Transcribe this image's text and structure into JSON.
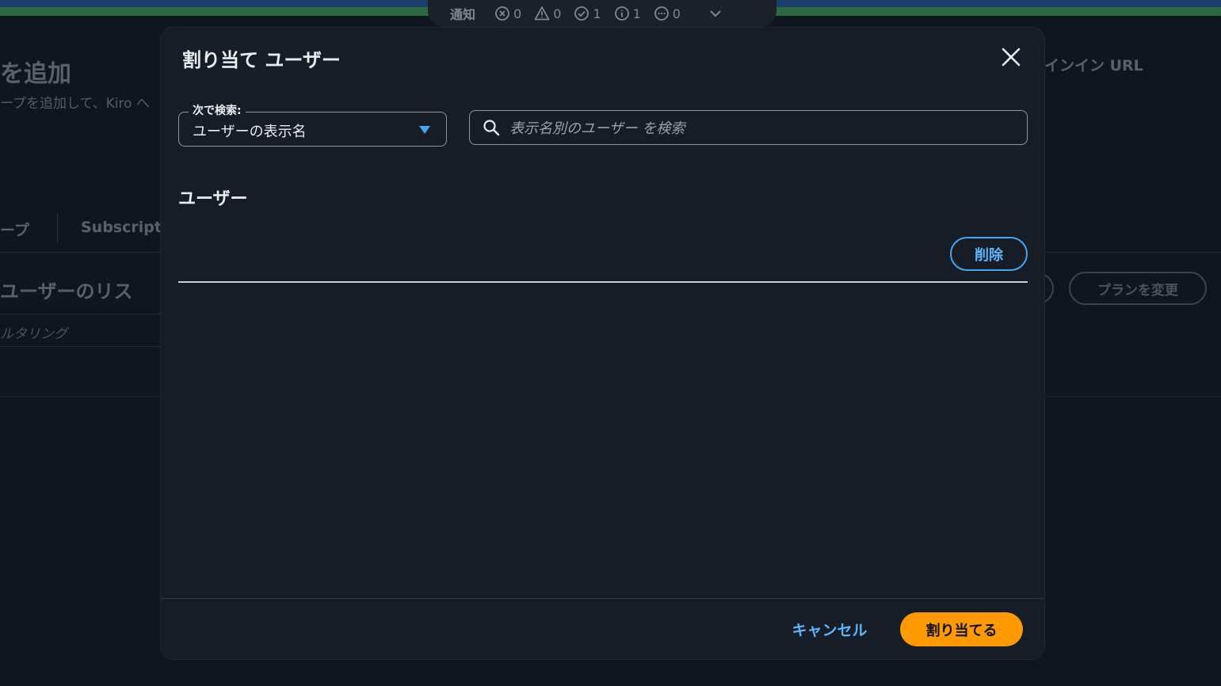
{
  "notifications": {
    "label": "通知",
    "items": [
      {
        "icon": "error-icon",
        "count": "0"
      },
      {
        "icon": "warning-icon",
        "count": "0"
      },
      {
        "icon": "success-icon",
        "count": "1"
      },
      {
        "icon": "info-icon",
        "count": "1"
      },
      {
        "icon": "pending-icon",
        "count": "0"
      }
    ]
  },
  "background": {
    "title": "を追加",
    "description": "ープを追加して、Kiro へ",
    "tabs": [
      "ープ",
      "Subscripti"
    ],
    "list_title": "ユーザーのリス",
    "filter_placeholder": "ルタリング",
    "signin_label": "インイン URL",
    "change_plan_button": "プランを変更"
  },
  "modal": {
    "title": "割り当て ユーザー",
    "search_by_label": "次で検索:",
    "search_by_value": "ユーザーの表示名",
    "search_placeholder": "表示名別のユーザー を検索",
    "section_title": "ユーザー",
    "remove_button": "削除",
    "cancel_button": "キャンセル",
    "assign_button": "割り当てる"
  },
  "colors": {
    "accent_blue": "#5cb6ff",
    "primary_orange": "#ff9900",
    "modal_background": "#161d26"
  }
}
